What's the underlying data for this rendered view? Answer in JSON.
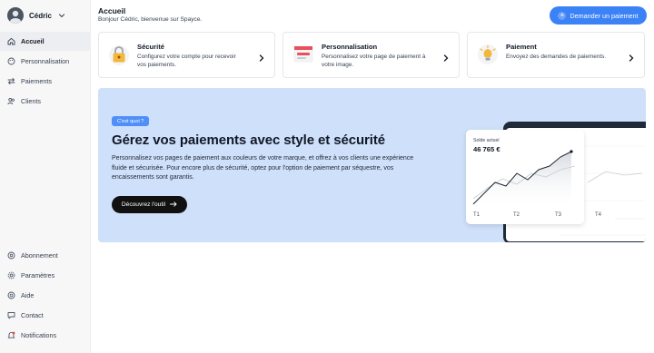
{
  "user": {
    "name": "Cédric"
  },
  "nav_top": [
    {
      "label": "Accueil",
      "icon": "home-icon",
      "active": true
    },
    {
      "label": "Personnalisation",
      "icon": "palette-icon",
      "active": false
    },
    {
      "label": "Paiements",
      "icon": "transfer-icon",
      "active": false
    },
    {
      "label": "Clients",
      "icon": "users-icon",
      "active": false
    }
  ],
  "nav_bottom": [
    {
      "label": "Abonnement",
      "icon": "subscription-icon"
    },
    {
      "label": "Paramètres",
      "icon": "gear-icon"
    },
    {
      "label": "Aide",
      "icon": "help-icon"
    },
    {
      "label": "Contact",
      "icon": "chat-icon"
    },
    {
      "label": "Notifications",
      "icon": "bell-icon"
    }
  ],
  "header": {
    "title": "Accueil",
    "subtitle": "Bonjour Cédric, bienvenue sur Spayce.",
    "cta_label": "Demander un paiement"
  },
  "cards": [
    {
      "title": "Sécurité",
      "description": "Configurez votre compte pour recevoir vos paiements.",
      "icon": "padlock-icon"
    },
    {
      "title": "Personnalisation",
      "description": "Personnalisez votre page de paiement à votre image.",
      "icon": "browser-window-icon"
    },
    {
      "title": "Paiement",
      "description": "Envoyez des demandes de paiements.",
      "icon": "payment-bulb-icon"
    }
  ],
  "banner": {
    "pill": "C'est quoi ?",
    "title": "Gérez vos paiements avec style et sécurité",
    "text": "Personnalisez vos pages de paiement aux couleurs de votre marque, et offrez à vos clients une expérience fluide et sécurisée. Pour encore plus de sécurité, optez pour l'option de paiement par séquestre, vos encaissements sont garantis.",
    "button_label": "Découvrez l'outil"
  },
  "balance_card": {
    "label": "Solde actuel",
    "value": "46 765 €",
    "ticks": [
      "T1",
      "T2",
      "T3",
      "T4"
    ]
  },
  "colors": {
    "accent": "#3b82f6",
    "banner_bg": "#cfe0fa",
    "sidebar_bg": "#f7f7f8"
  }
}
